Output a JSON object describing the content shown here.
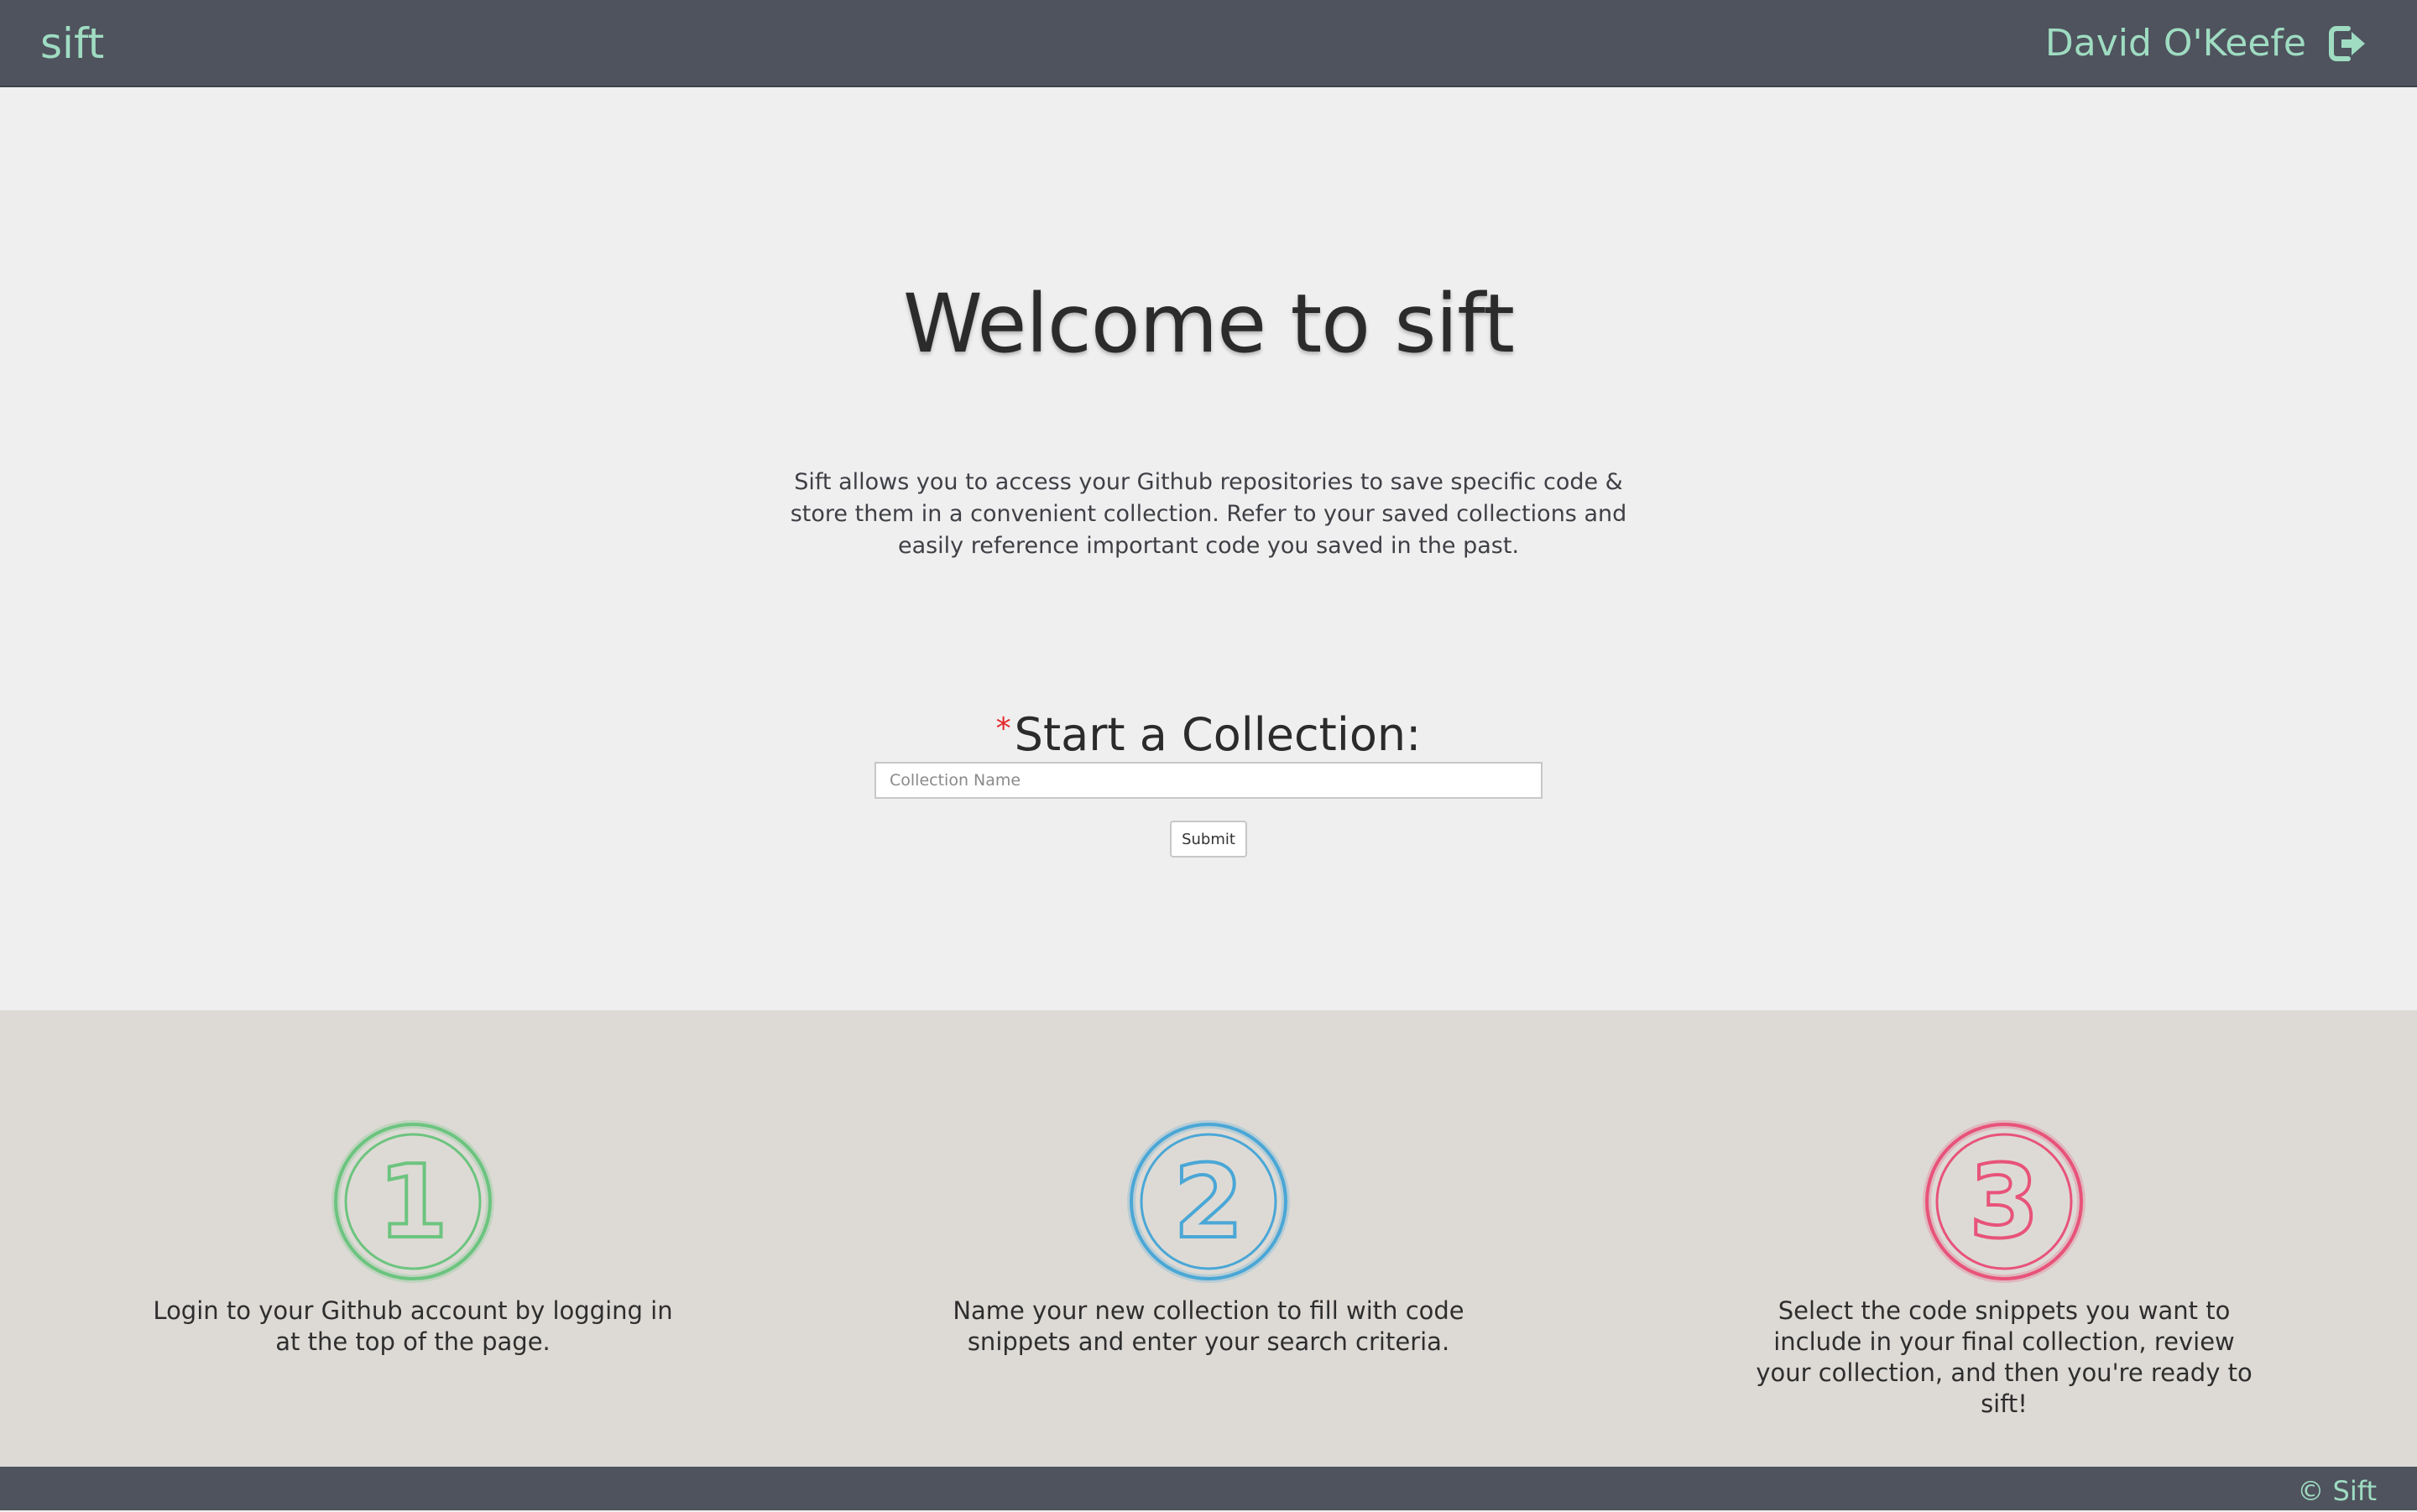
{
  "header": {
    "brand": "sift",
    "user_name": "David O'Keefe",
    "logout_icon": "sign-out-icon"
  },
  "hero": {
    "title": "Welcome to sift",
    "description": "Sift allows you to access your Github repositories to save specific code & store them in a convenient collection. Refer to your saved collections and easily reference important code you saved in the past."
  },
  "collection_form": {
    "required_mark": "*",
    "heading": "Start a Collection:",
    "input_value": "",
    "input_placeholder": "Collection Name",
    "submit_label": "Submit"
  },
  "steps": [
    {
      "number": "1",
      "color": "#6cc47f",
      "text": "Login to your Github account by logging in at the top of the page."
    },
    {
      "number": "2",
      "color": "#4aa7d6",
      "text": "Name your new collection to fill with code snippets and enter your search criteria."
    },
    {
      "number": "3",
      "color": "#e8537a",
      "text": "Select the code snippets you want to include in your final collection, review your collection, and then you're ready to sift!"
    }
  ],
  "footer": {
    "copyright": "© Sift"
  },
  "colors": {
    "nav_bg": "#4f535e",
    "accent": "#9fdcc2",
    "page_bg": "#efefef",
    "steps_bg": "#dddad5"
  }
}
